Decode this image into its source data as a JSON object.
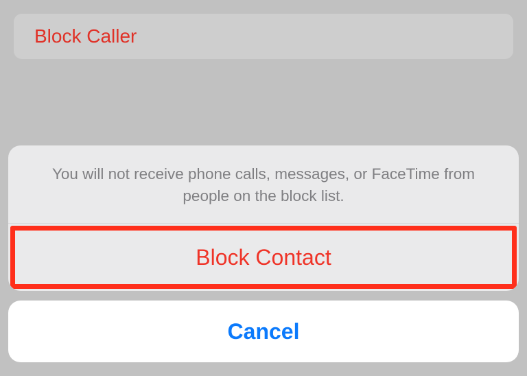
{
  "page": {
    "block_caller_label": "Block Caller"
  },
  "action_sheet": {
    "message": "You will not receive phone calls, messages, or FaceTime from people on the block list.",
    "block_contact_label": "Block Contact",
    "cancel_label": "Cancel"
  }
}
